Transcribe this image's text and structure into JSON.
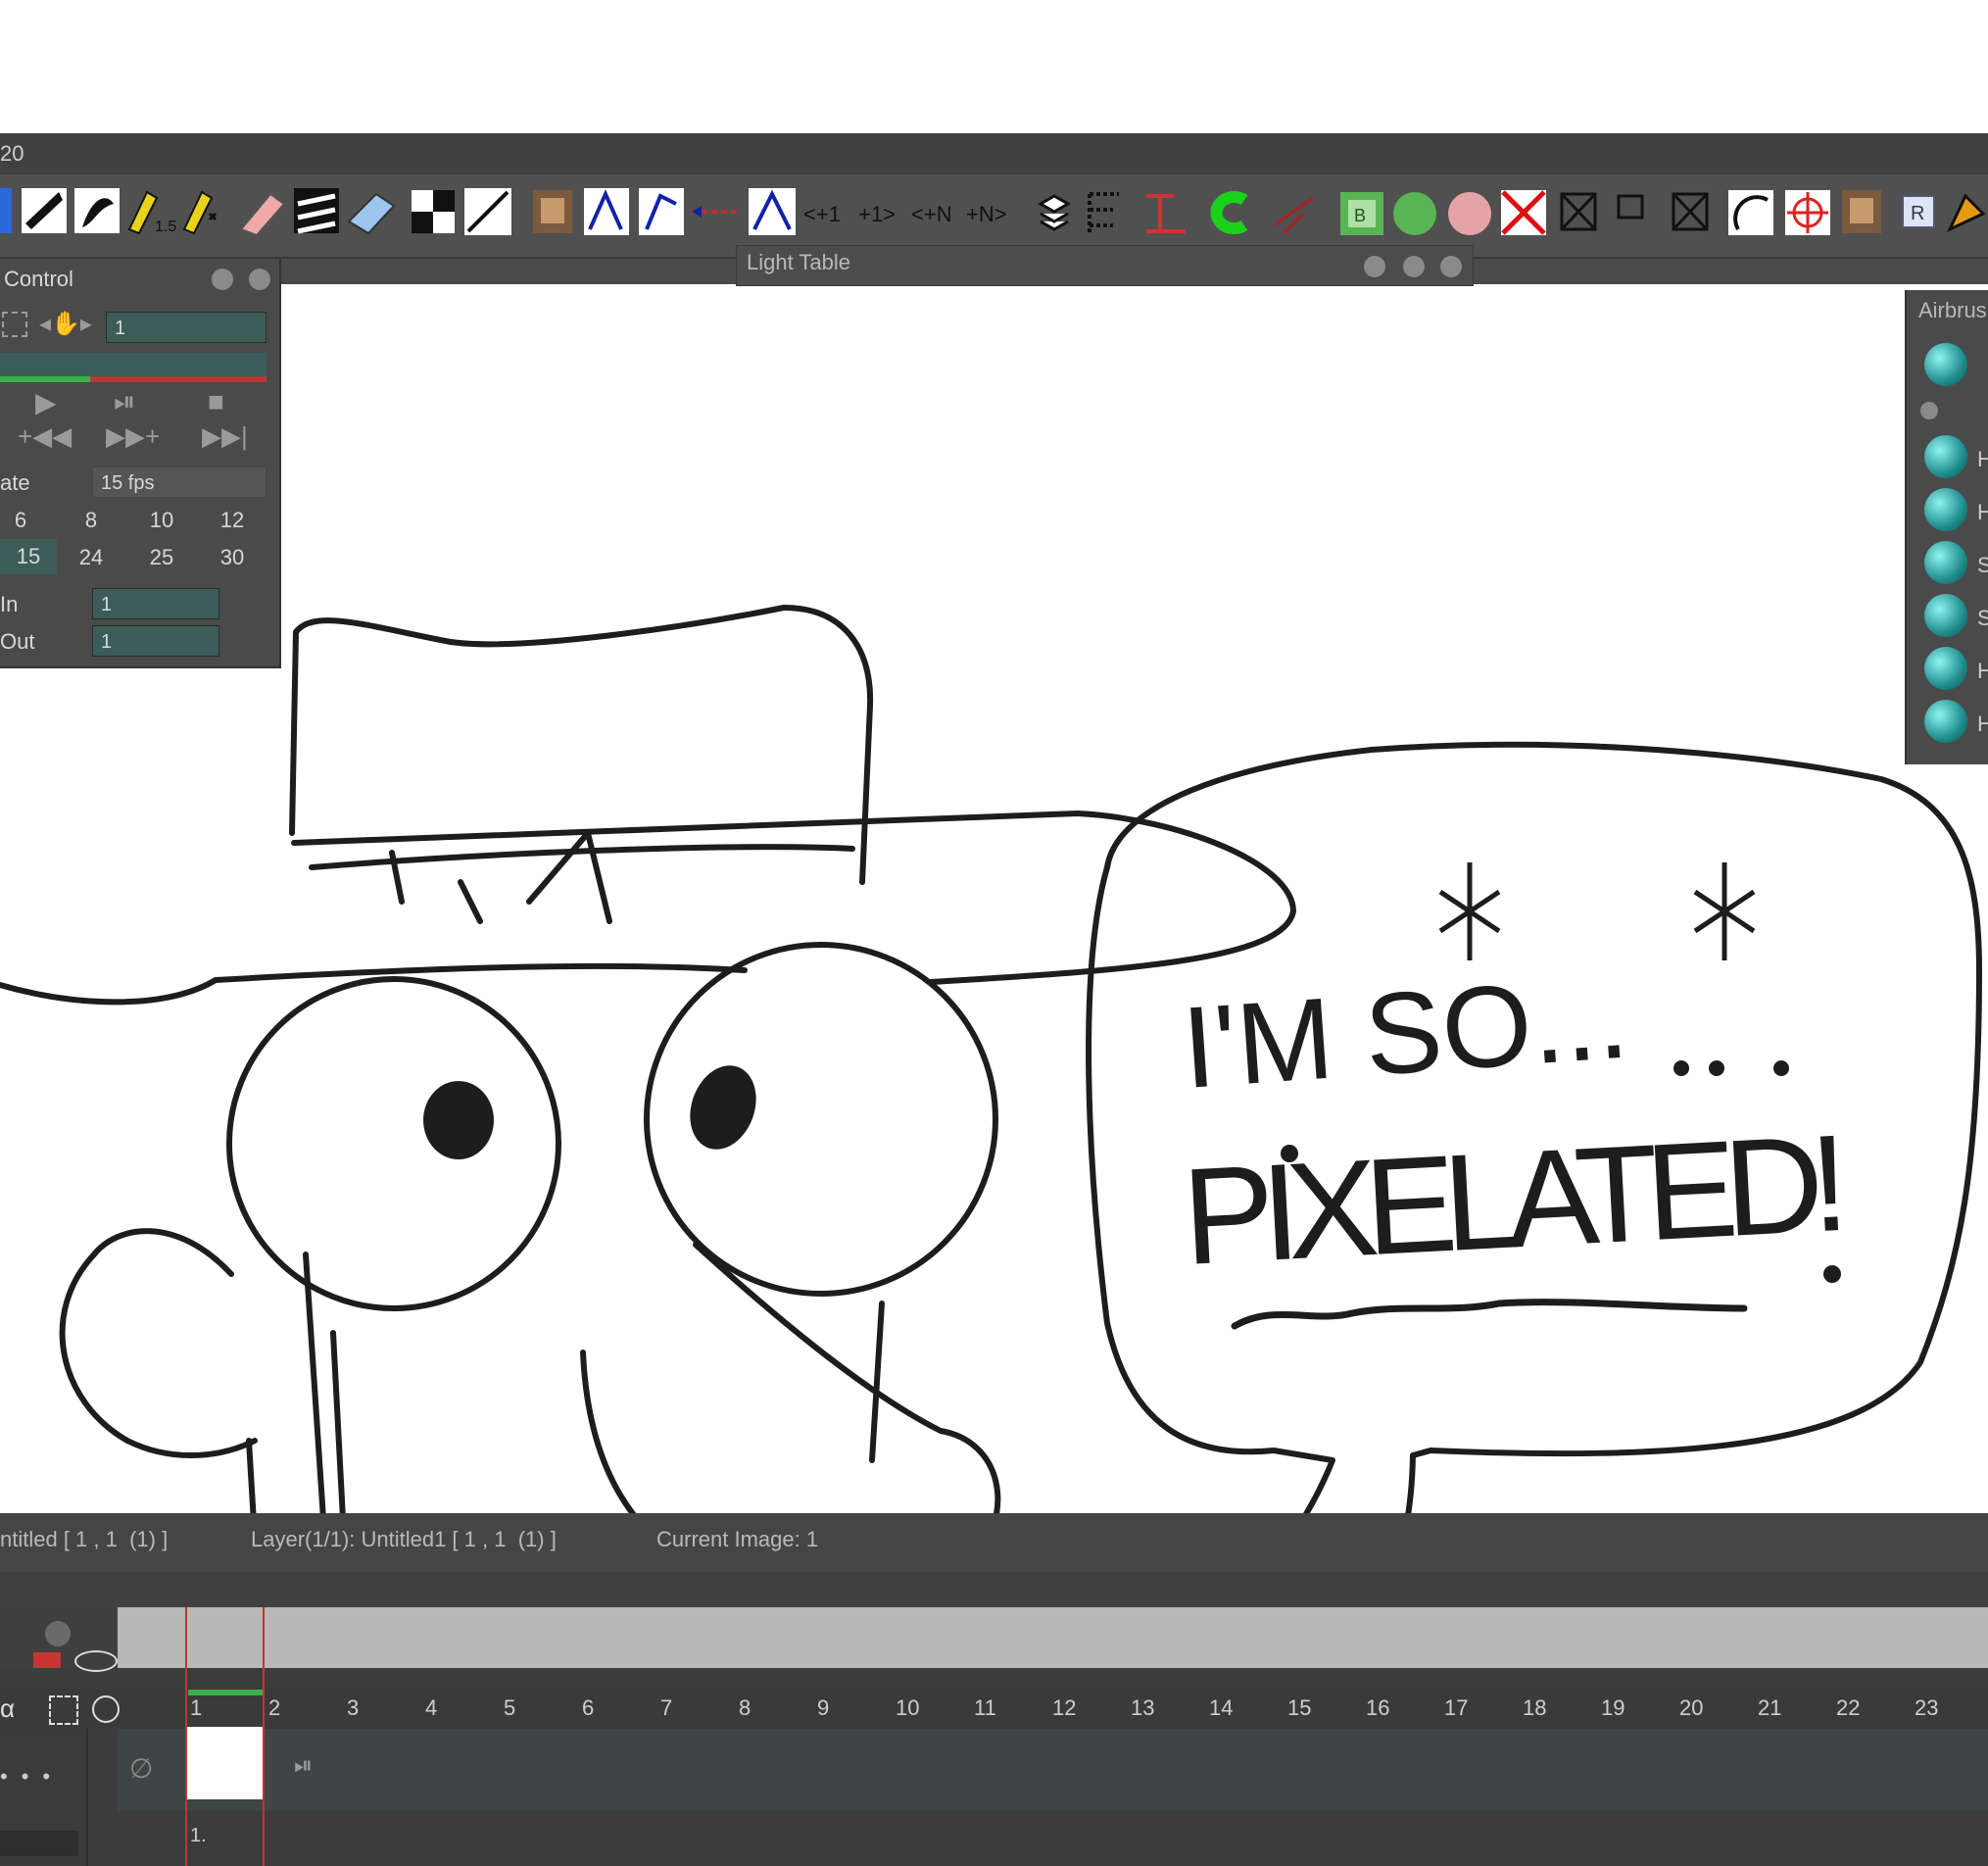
{
  "window": {
    "title_fragment": "20"
  },
  "toolbar": {
    "icons": [
      "color-swatch-icon",
      "ink-pen-icon",
      "brush-icon",
      "pencil-icon",
      "pencil-star-icon",
      "eraser-pen-icon",
      "stroke-icon",
      "eraser-icon",
      "checker-icon",
      "line-icon",
      "horse-icon",
      "arrow-left-icon",
      "arrow-icon",
      "arrow-red-icon",
      "arrow-right-icon",
      "prev-1-icon",
      "next-1-icon",
      "prev-n-icon",
      "next-n-icon",
      "layers-icon",
      "tree-icon",
      "tree-red-icon",
      "green-c-icon",
      "rotate-icon",
      "b-box-icon",
      "green-blob-icon",
      "pink-blob-icon",
      "x-red-icon",
      "x-box-icon",
      "frame-icon",
      "x-box2-icon",
      "arc-icon",
      "target-icon",
      "horse2-icon",
      "r-icon",
      "orange-icon"
    ]
  },
  "light_table": {
    "title": "Light Table"
  },
  "playback": {
    "title": "Control",
    "frame_value": "1",
    "rate_label": "ate",
    "fps_value": "15 fps",
    "rates_row1": [
      "6",
      "8",
      "10",
      "12"
    ],
    "rates_row2": [
      "15",
      "24",
      "25",
      "30"
    ],
    "in_label": "In",
    "in_value": "1",
    "out_label": "Out",
    "out_value": "1"
  },
  "airbrush": {
    "title": "Airbrus",
    "brush_letters": [
      "H",
      "H",
      "S",
      "S",
      "H",
      "H"
    ]
  },
  "drawing": {
    "line1": "I'M SO...",
    "line2": "PIXELATED!"
  },
  "status": {
    "scene": "ntitled [ 1 , 1  (1) ]",
    "layer": "Layer(1/1): Untitled1 [ 1 , 1  (1) ]",
    "current": "Current Image: 1"
  },
  "timeline": {
    "frames": [
      "1",
      "2",
      "3",
      "4",
      "5",
      "6",
      "7",
      "8",
      "9",
      "10",
      "11",
      "12",
      "13",
      "14",
      "15",
      "16",
      "17",
      "18",
      "19",
      "20",
      "21",
      "22",
      "23"
    ],
    "cell_label": "1."
  }
}
